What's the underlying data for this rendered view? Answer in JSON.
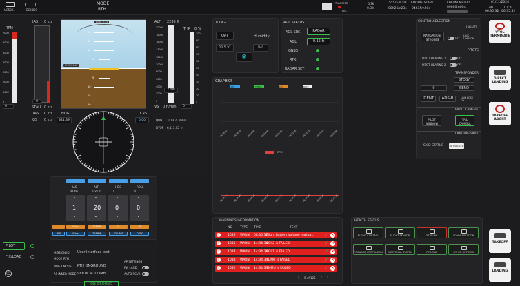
{
  "topbar": {
    "drone_ids": [
      "UC5001",
      "EGH001"
    ],
    "mode_label": "MODE",
    "mode_value": "RTH",
    "transfer_label": "TRANSFER",
    "rec_label": "REC",
    "disk_label": "DISK",
    "disk_value": "0.3%",
    "system_up_label": "SYSTEM UP",
    "system_up_value": "00h26m23s",
    "engine_start_label": "ENGINE START",
    "engine_start_value": "04h15m50s",
    "chronometers_label": "CHRONOMETERS",
    "chrono_value": "00h00m00s",
    "date": "01/11/2024",
    "gmt_label": "GMT",
    "local_label": "LOCAL",
    "gmt_time": "06:35:32",
    "local_time": "06:35:32"
  },
  "flight": {
    "rpm_label": "RPM",
    "rpm_ticks": [
      "7000",
      "6000",
      "5000",
      "4000",
      "3000",
      "2000",
      "1000",
      "0"
    ],
    "rpm_value": "0",
    "ias_label": "IAS",
    "ias_unit": "0 kts",
    "ias_value": "0",
    "stall_label": "STALL",
    "stall_value": "0 kts",
    "tas_label": "TAS",
    "tas_value": "0 kts",
    "gs_label": "GS",
    "gs_value": "0 kts",
    "bank_label": "BNK -0.35",
    "pitch_label": "PITCH 1.6°",
    "pitch_marks": [
      "20",
      "15",
      "10",
      "5",
      "5",
      "10",
      "15",
      "20"
    ],
    "alt_label": "ALT",
    "alt_top": "2298 ft",
    "alt_ticks": [
      "20000",
      "18000",
      "16000",
      "14000",
      "12000",
      "10000",
      "8000",
      "6000",
      "4000",
      "2000",
      "0"
    ],
    "alt_value": "2298",
    "vs_label": "VS",
    "vs_value": "0 ft/min",
    "thr_label": "THR",
    "thr_unit": "0 %",
    "thr_ticks": [
      "100",
      "90",
      "80",
      "70",
      "60",
      "50",
      "40",
      "30",
      "20",
      "10",
      "0"
    ],
    "thr_value": "0",
    "hdg_label": "HDG",
    "hdg_value": "321.39",
    "crs_label": "CRS",
    "crs_value": "0.00",
    "qnh_label": "QNH",
    "qnh_value": "1013.2",
    "qnh_unit": "mbar",
    "dtop_label": "DTOP",
    "dtop_value": "6,413.05",
    "dtop_unit": "m"
  },
  "icing": {
    "title": "ICING",
    "oat_label": "OAT",
    "oat_value": "12.5 °C",
    "humidity_label": "Humidity",
    "humidity_value": "% 0"
  },
  "agl": {
    "title": "AGL STATUS",
    "src_label": "AGL SRC",
    "src_value": "RADAR",
    "agl_label": "AGL",
    "agl_value": "0.15 ft",
    "gnss_label": "GNSS",
    "rtk_label": "RTK",
    "radar_set_label": "RADAR SET"
  },
  "graphics": {
    "title": "GRAPHICS",
    "legend": [
      {
        "name": "PHI",
        "color": "#3aa0e0"
      },
      {
        "name": "THETA",
        "color": "#3bbf4a"
      },
      {
        "name": "PSI",
        "color": "#e08a2a"
      },
      {
        "name": "RATE",
        "color": "#f0f0f0"
      }
    ],
    "y_ticks_top": [
      "",
      "",
      "",
      "",
      ""
    ],
    "x_ticks": [
      "06:34:10",
      "06:34:20",
      "06:34:30",
      "06:34:40",
      "06:34:50",
      "06:35:00",
      "06:35:10",
      "06:35:20",
      "06:35:30"
    ],
    "rpm_legend": "RPM",
    "y_ticks_bottom": [
      "",
      "",
      "",
      "",
      "",
      ""
    ]
  },
  "controls": {
    "tab1": "CONTROL",
    "tab2": "SELECTION",
    "lights_label": "LIGHTS",
    "nav_strobes": "NAVIGATION/ STROBES",
    "off": "OFF",
    "link_loss_on": "LINK LOSS ON",
    "pitots_label": "PITOTS",
    "pitot1": "PITOT HEATING 1",
    "pitot2": "PITOT HEATING 2",
    "transponder_label": "TRANSPONDER",
    "stdby": "STDBY",
    "squawk": "0",
    "send": "SEND",
    "ident": "IDENT",
    "adsb": "ADS-B",
    "pilot_camera_label": "PILOT CAMERA",
    "pilot_window": "PILOT WINDOW",
    "tail_camera": "TAIL CAMERA",
    "landing_skid_label": "LANDING SKID",
    "skid_status": "SKID STATUS",
    "retracted": "RETRACTED"
  },
  "side_actions": [
    {
      "label": "VTOL TERMINATE"
    },
    {
      "label": "DIRECT LANDING"
    },
    {
      "label": "TAKEOFF ABORT"
    },
    {
      "label": "TAKEOFF"
    },
    {
      "label": "LANDING"
    }
  ],
  "manual": {
    "headers": [
      "IAS",
      "ALT",
      "HDG",
      "ROLL"
    ],
    "header_values": [
      "44 kts",
      "2520 ft",
      "0",
      "0"
    ],
    "values": [
      "1",
      "20",
      "0",
      "0"
    ],
    "bottom_orange": [
      "0 kts",
      "2298 ft",
      "0°",
      "0°"
    ],
    "ref_label": "REF",
    "ref_values": [
      "0 kts",
      "2298 ft",
      "321.39°",
      "-0.35°"
    ]
  },
  "left_modes": {
    "pilot": "PILOT",
    "fixload": "FIX/LOAD"
  },
  "mission": {
    "mission_id_label": "MISSION ID",
    "mission_id_value": "User Interface test",
    "mode_label": "MODE",
    "mode_value": "RTH",
    "inner_mode_label": "INNER MODE",
    "inner_mode_value": "RTH ONGROUND",
    "ap_inner_mode_label": "AP INNER MODE",
    "ap_inner_mode_value": "VERTICAL CLIMB",
    "ap_settings_label": "AP SETTINGS",
    "fw_land": "FW LAND",
    "auto_rcvr": "AUTO RCVR",
    "on_ground": "ON GROUND"
  },
  "warnings": {
    "title": "WARNINGS/INFORMATION",
    "cols": [
      "NO",
      "TYPE",
      "TIME",
      "TEXT"
    ],
    "rows": [
      {
        "no": "1036",
        "type": "WARN",
        "time": "08:35:32",
        "text": "Flight battery voltage low(ba..."
      },
      {
        "no": "1035",
        "type": "WARN",
        "time": "14:34:34",
        "text": "EGI-2 is FAILED"
      },
      {
        "no": "1034",
        "type": "WARN",
        "time": "14:34:34",
        "text": "EGI-1 is FAILED"
      },
      {
        "no": "1033",
        "type": "WARN",
        "time": "14:34:34",
        "text": "TDMU is FAILED"
      },
      {
        "no": "1032",
        "type": "WARN",
        "time": "14:34:34",
        "text": "TMMU is FAILED"
      }
    ],
    "pagination": "1 — 5 of 125"
  },
  "health": {
    "title": "HEALTH STATUS",
    "items": [
      {
        "label": "FLIGHT CONTROL",
        "color": "#4f8f4f"
      },
      {
        "label": "FLIGHT SENSOR",
        "color": "#4f8f4f"
      },
      {
        "label": "DATALINK",
        "color": "#c83030"
      },
      {
        "label": "COMMUNICATION",
        "color": "#4f8f4f"
      },
      {
        "label": "FORWARD PROPULSION",
        "color": "#4f8f4f"
      },
      {
        "label": "ELECTRICAL SYSTEM",
        "color": "#4f8f4f"
      },
      {
        "label": "PAYLOAD",
        "color": "#4f8f4f"
      },
      {
        "label": "OTHER SYSTEMS",
        "color": "#4f8f4f"
      }
    ]
  }
}
